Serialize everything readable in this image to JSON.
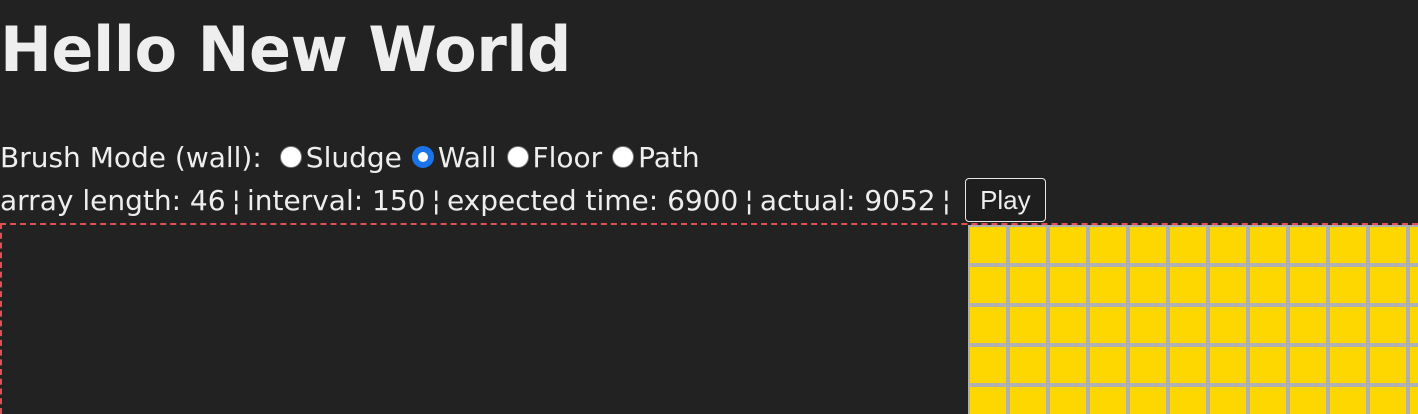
{
  "page": {
    "title": "Hello New World"
  },
  "brush": {
    "label": "Brush Mode (wall):",
    "options": [
      {
        "label": "Sludge",
        "checked": false
      },
      {
        "label": "Wall",
        "checked": true
      },
      {
        "label": "Floor",
        "checked": false
      },
      {
        "label": "Path",
        "checked": false
      }
    ]
  },
  "stats": {
    "array_length": "array length: 46",
    "interval": "interval: 150",
    "expected_time": "expected time: 6900",
    "actual": "actual: 9052",
    "separator": "¦"
  },
  "controls": {
    "play_label": "Play"
  },
  "colors": {
    "background": "#222222",
    "cell_fill": "#ffd700",
    "grid_line": "#b0b0b0",
    "canvas_border": "#e05050",
    "radio_checked": "#1a73e8"
  }
}
